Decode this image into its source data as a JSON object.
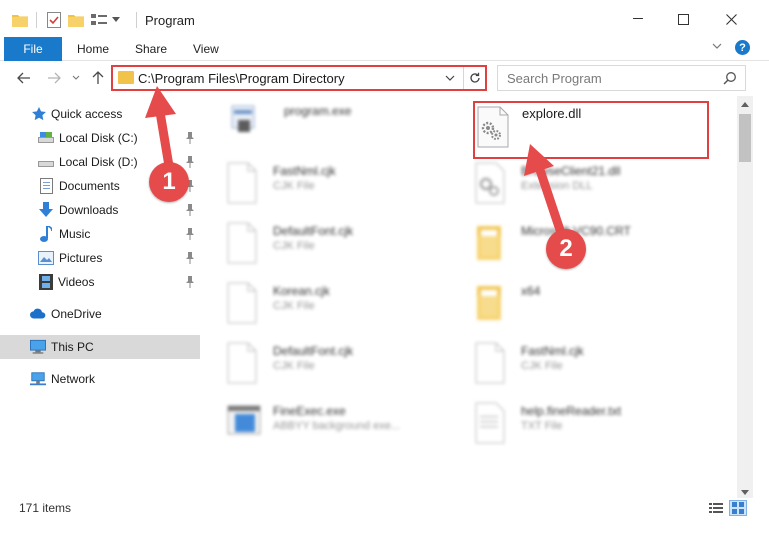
{
  "window": {
    "title": "Program",
    "controls": {
      "minimize": "minimize",
      "maximize": "maximize",
      "close": "close"
    }
  },
  "ribbon": {
    "tabs": [
      {
        "label": "File"
      },
      {
        "label": "Home"
      },
      {
        "label": "Share"
      },
      {
        "label": "View"
      }
    ],
    "help_label": "?"
  },
  "navigation": {
    "address": "C:\\Program Files\\Program Directory",
    "search_placeholder": "Search Program"
  },
  "sidebar": {
    "items": [
      {
        "label": "Quick access",
        "icon": "star-icon",
        "pinned": false
      },
      {
        "label": "Local Disk (C:)",
        "icon": "drive-icon",
        "pinned": true
      },
      {
        "label": "Local Disk (D:)",
        "icon": "drive-icon",
        "pinned": true
      },
      {
        "label": "Documents",
        "icon": "documents-icon",
        "pinned": true
      },
      {
        "label": "Downloads",
        "icon": "download-arrow-icon",
        "pinned": true
      },
      {
        "label": "Music",
        "icon": "music-note-icon",
        "pinned": true
      },
      {
        "label": "Pictures",
        "icon": "pictures-icon",
        "pinned": true
      },
      {
        "label": "Videos",
        "icon": "film-icon",
        "pinned": true
      },
      {
        "label": "OneDrive",
        "icon": "cloud-icon",
        "pinned": false
      },
      {
        "label": "This PC",
        "icon": "monitor-icon",
        "pinned": false,
        "selected": true
      },
      {
        "label": "Network",
        "icon": "network-icon",
        "pinned": false
      }
    ]
  },
  "files": {
    "left_column": [
      {
        "name": "program.exe",
        "type": ""
      },
      {
        "name": "FastNml.cjk",
        "type": "CJK File"
      },
      {
        "name": "DefaultFont.cjk",
        "type": "CJK File"
      },
      {
        "name": "Korean.cjk",
        "type": "CJK File"
      },
      {
        "name": "DefaultFont.cjk",
        "type": "CJK File"
      },
      {
        "name": "FineExec.exe",
        "type": "ABBYY background exe..."
      }
    ],
    "right_column": [
      {
        "name": "explore.dll",
        "type": ""
      },
      {
        "name": "BrowseClient21.dll",
        "type": "Extension DLL"
      },
      {
        "name": "Microsoft.VC90.CRT",
        "type": ""
      },
      {
        "name": "x64",
        "type": ""
      },
      {
        "name": "FastNml.cjk",
        "type": "CJK File"
      },
      {
        "name": "help.fineReader.txt",
        "type": "TXT File"
      }
    ]
  },
  "status": {
    "item_count": "171 items"
  },
  "callouts": {
    "step1": "1",
    "step2": "2"
  },
  "colors": {
    "accent": "#1979ca",
    "highlight": "#e04040",
    "callout": "#e64b4b",
    "folder": "#f2c34a"
  }
}
